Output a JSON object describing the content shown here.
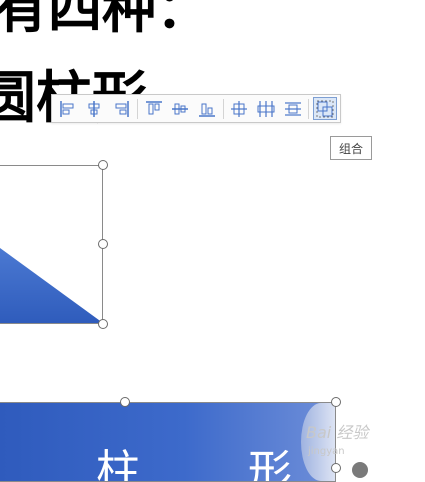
{
  "slide": {
    "heading_top": "有四种：",
    "heading_main": "圆柱形",
    "banner_char_1": "柱",
    "banner_char_2": "形"
  },
  "toolbar": {
    "tools": [
      {
        "id": "align-left",
        "icon": "align-left-icon"
      },
      {
        "id": "align-center",
        "icon": "align-center-icon"
      },
      {
        "id": "align-right",
        "icon": "align-right-icon"
      },
      {
        "id": "align-top",
        "icon": "align-top-icon"
      },
      {
        "id": "align-middle",
        "icon": "align-middle-icon"
      },
      {
        "id": "align-bottom",
        "icon": "align-bottom-icon"
      },
      {
        "id": "distribute-center",
        "icon": "distribute-center-icon"
      },
      {
        "id": "distribute-horizontal",
        "icon": "distribute-horizontal-icon"
      },
      {
        "id": "distribute-vertical",
        "icon": "distribute-vertical-icon"
      },
      {
        "id": "group",
        "icon": "group-icon",
        "active": true
      }
    ],
    "tooltip": "组合"
  },
  "watermark": {
    "text": "Bai 经验",
    "sub": "jingyan"
  },
  "colors": {
    "shape_blue": "#3361c4",
    "toolbar_active": "#dbe7f7",
    "icon_blue": "#4a76c9"
  }
}
